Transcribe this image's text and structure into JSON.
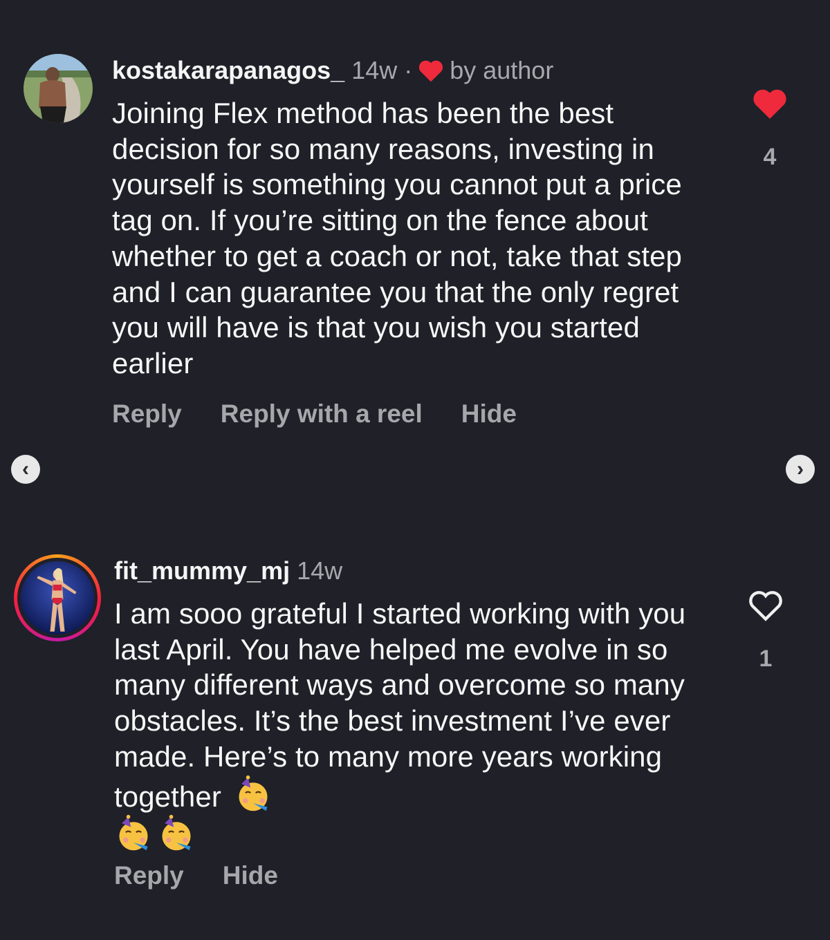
{
  "comments": [
    {
      "username": "kostakarapanagos_",
      "time": "14w",
      "separator": "·",
      "author_liked_label": "by author",
      "text": "Joining Flex method has been the best decision for so many reasons, investing in yourself is something you cannot put a price tag on. If you’re sitting on the fence about whether to get a coach or not, take that step and I can guarantee you that the only regret you will have is that you wish you started earlier",
      "likes": "4",
      "liked": true,
      "actions": [
        "Reply",
        "Reply with a reel",
        "Hide"
      ]
    },
    {
      "username": "fit_mummy_mj",
      "time": "14w",
      "text": "I am sooo grateful I started working with you last April. You have helped me evolve in so many different ways and overcome so many obstacles. It’s the best investment I’ve ever made. Here’s to many more years working together",
      "emojis": [
        "partying-face-emoji",
        "partying-face-emoji",
        "partying-face-emoji"
      ],
      "likes": "1",
      "liked": false,
      "actions": [
        "Reply",
        "Hide"
      ]
    }
  ],
  "navigation": {
    "prev_icon": "chevron-left-icon",
    "next_icon": "chevron-right-icon",
    "prev_glyph": "‹",
    "next_glyph": "›"
  },
  "colors": {
    "background": "#1f2028",
    "like_red": "#ee2a3c",
    "muted_text": "#a8a8ad"
  }
}
